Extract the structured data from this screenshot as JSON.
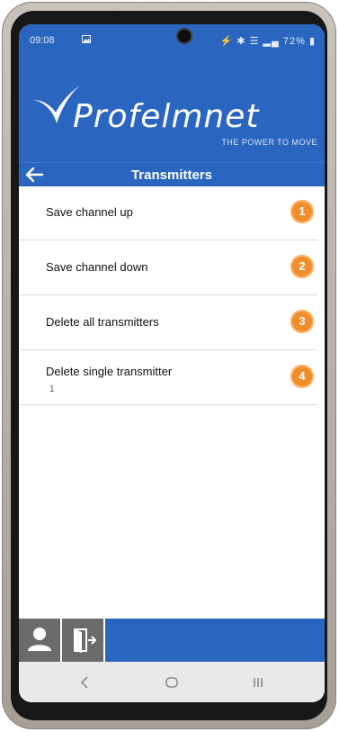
{
  "status_bar": {
    "time": "09:08",
    "battery": "72%"
  },
  "brand": {
    "logo": "Profelmnet",
    "tagline": "THE POWER TO MOVE"
  },
  "header": {
    "title": "Transmitters"
  },
  "menu": {
    "items": [
      {
        "label": "Save channel up",
        "badge": "1",
        "sub": ""
      },
      {
        "label": "Save channel down",
        "badge": "2",
        "sub": ""
      },
      {
        "label": "Delete all transmitters",
        "badge": "3",
        "sub": ""
      },
      {
        "label": "Delete single transmitter",
        "badge": "4",
        "sub": "1"
      }
    ]
  },
  "icons": {
    "back": "back-arrow-icon",
    "user": "user-icon",
    "exit": "exit-door-icon",
    "nav_back": "nav-back-icon",
    "nav_home": "nav-home-icon",
    "nav_recents": "nav-recents-icon"
  },
  "colors": {
    "primary": "#2a65c0",
    "badge": "#f08d2c",
    "bottom_button": "#6b6b6b"
  }
}
